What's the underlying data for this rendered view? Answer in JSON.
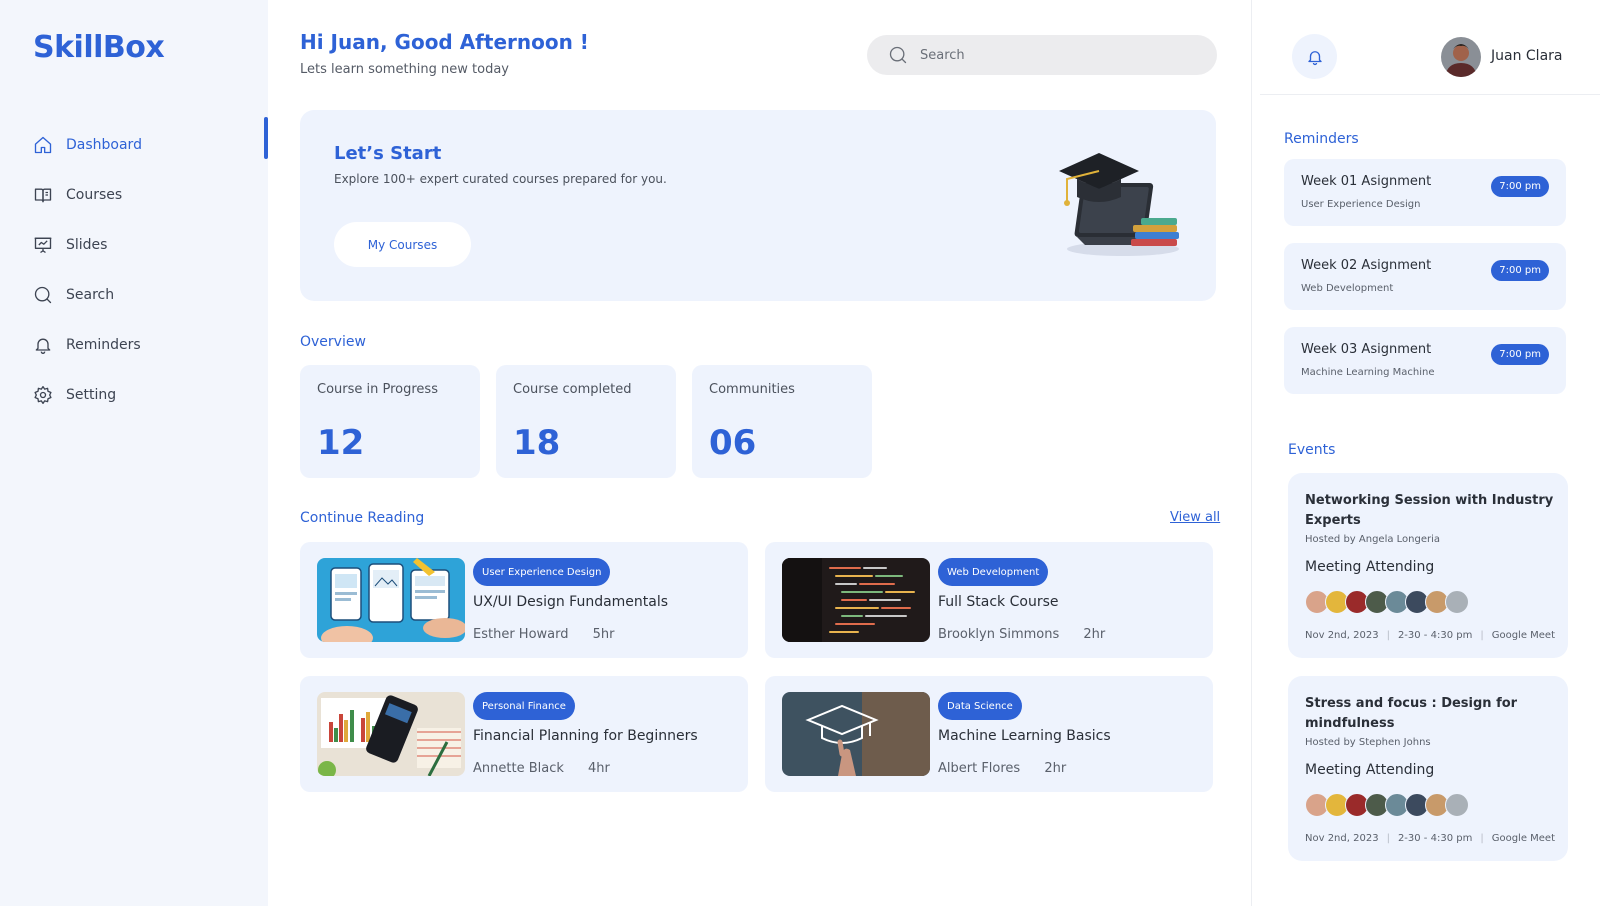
{
  "app": {
    "logo": "SkillBox"
  },
  "sidebar": {
    "items": [
      {
        "label": "Dashboard",
        "icon": "home-icon"
      },
      {
        "label": "Courses",
        "icon": "book-icon"
      },
      {
        "label": "Slides",
        "icon": "presentation-icon"
      },
      {
        "label": "Search",
        "icon": "search-icon"
      },
      {
        "label": "Reminders",
        "icon": "bell-icon"
      },
      {
        "label": "Setting",
        "icon": "gear-icon"
      }
    ],
    "active": "Dashboard"
  },
  "header": {
    "greeting": "Hi Juan, Good Afternoon !",
    "subtitle": "Lets learn something new today",
    "search_placeholder": "Search"
  },
  "hero": {
    "title": "Let’s Start",
    "subtitle": "Explore 100+ expert curated courses prepared for you.",
    "button": "My Courses"
  },
  "overview": {
    "title": "Overview",
    "stats": [
      {
        "label": "Course in Progress",
        "value": "12"
      },
      {
        "label": "Course completed",
        "value": "18"
      },
      {
        "label": "Communities",
        "value": "06"
      }
    ]
  },
  "reading": {
    "title": "Continue Reading",
    "view_all": "View all",
    "courses": [
      {
        "tag": "User Experience Design",
        "title": "UX/UI Design Fundamentals",
        "author": "Esther Howard",
        "duration": "5hr"
      },
      {
        "tag": "Web Development",
        "title": "Full Stack Course",
        "author": "Brooklyn Simmons",
        "duration": "2hr"
      },
      {
        "tag": "Personal Finance",
        "title": "Financial Planning for Beginners",
        "author": "Annette Black",
        "duration": "4hr"
      },
      {
        "tag": "Data Science",
        "title": "Machine Learning Basics",
        "author": "Albert Flores",
        "duration": "2hr"
      }
    ]
  },
  "user": {
    "name": "Juan Clara"
  },
  "reminders": {
    "title": "Reminders",
    "items": [
      {
        "title": "Week 01 Asignment",
        "subtitle": "User Experience Design",
        "time": "7:00 pm"
      },
      {
        "title": "Week 02 Asignment",
        "subtitle": "Web Development",
        "time": "7:00 pm"
      },
      {
        "title": "Week 03 Asignment",
        "subtitle": "Machine Learning Machine",
        "time": "7:00 pm"
      }
    ]
  },
  "events": {
    "title": "Events",
    "items": [
      {
        "title": "Networking Session with Industry Experts",
        "host": "Hosted by Angela Longeria",
        "status": "Meeting Attending",
        "date": "Nov 2nd, 2023",
        "time": "2-30 - 4:30 pm",
        "platform": "Google Meet"
      },
      {
        "title": "Stress and focus : Design for mindfulness",
        "host": "Hosted by Stephen Johns",
        "status": "Meeting Attending",
        "date": "Nov 2nd, 2023",
        "time": "2-30 - 4:30 pm",
        "platform": "Google Meet"
      }
    ]
  },
  "colors": {
    "accent": "#2e62d6",
    "panel": "#eef3fd",
    "sidebar": "#f3f6fc"
  }
}
